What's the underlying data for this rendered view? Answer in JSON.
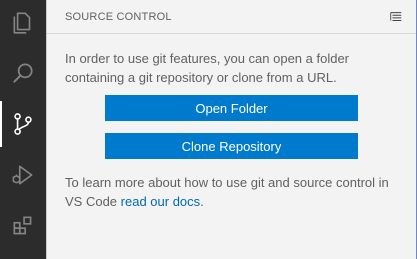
{
  "activity_bar": {
    "items": [
      {
        "name": "explorer",
        "icon": "files-icon",
        "active": false
      },
      {
        "name": "search",
        "icon": "search-icon",
        "active": false
      },
      {
        "name": "source-control",
        "icon": "source-control-icon",
        "active": true
      },
      {
        "name": "run-debug",
        "icon": "run-debug-icon",
        "active": false
      },
      {
        "name": "extensions",
        "icon": "extensions-icon",
        "active": false
      }
    ]
  },
  "panel": {
    "title": "SOURCE CONTROL",
    "header_action_icon": "list-tree-icon",
    "message_intro": "In order to use git features, you can open a folder containing a git repository or clone from a URL.",
    "open_folder_label": "Open Folder",
    "clone_repo_label": "Clone Repository",
    "learn_text_prefix": "To learn more about how to use git and source control in VS Code ",
    "learn_link": "read our docs",
    "learn_text_suffix": "."
  },
  "colors": {
    "activity_bar_bg": "#2c2c2c",
    "sidebar_bg": "#f3f3f3",
    "button_bg": "#007acc",
    "link": "#006ab1"
  }
}
